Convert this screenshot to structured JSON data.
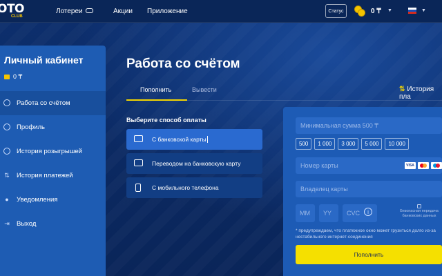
{
  "header": {
    "logo_text": "OTO",
    "logo_sub": "CLUB",
    "nav": [
      "Лотереи",
      "Акции",
      "Приложение"
    ],
    "status_label": "Статус",
    "balance": "0 ₸",
    "flag_colors": [
      "#ffffff",
      "#1c4fb8",
      "#d52b1e"
    ]
  },
  "sidebar": {
    "title": "Личный кабинет",
    "balance": "0 ₸",
    "items": [
      {
        "label": "Работа со счётом",
        "icon": "wallet-icon"
      },
      {
        "label": "Профиль",
        "icon": "user-icon"
      },
      {
        "label": "История розыгрышей",
        "icon": "history-icon"
      },
      {
        "label": "История платежей",
        "icon": "arrows-icon"
      },
      {
        "label": "Уведомления",
        "icon": "bell-icon"
      },
      {
        "label": "Выход",
        "icon": "logout-icon"
      }
    ]
  },
  "main": {
    "title": "Работа со счётом",
    "tabs": [
      "Пополнить",
      "Вывести"
    ],
    "history_link": "История пла",
    "pay_heading": "Выберите способ оплаты",
    "pay_options": [
      "С банковской карты",
      "Переводом на банковскую карту",
      "С мобильного телефона"
    ]
  },
  "form": {
    "amount_placeholder": "Минимальная сумма 500 ₸",
    "chips": [
      "500",
      "1 000",
      "3 000",
      "5 000",
      "10 000"
    ],
    "card_number_placeholder": "Номер карты",
    "card_brands": [
      "VISA",
      "MC",
      "MC"
    ],
    "holder_placeholder": "Владелец карты",
    "mm_placeholder": "ММ",
    "yy_placeholder": "YY",
    "cvc_placeholder": "CVC",
    "info_symbol": "i",
    "secure_text": "Безопасная передача банковских данных",
    "note": "* предупреждаем, что платежное окно может грузиться долго из-за нестабильного интернет-соединения",
    "submit_label": "Пополнить"
  },
  "colors": {
    "accent_yellow": "#f5e000",
    "panel_blue": "#1d5bb5",
    "bg_navy": "#0b2a63"
  }
}
